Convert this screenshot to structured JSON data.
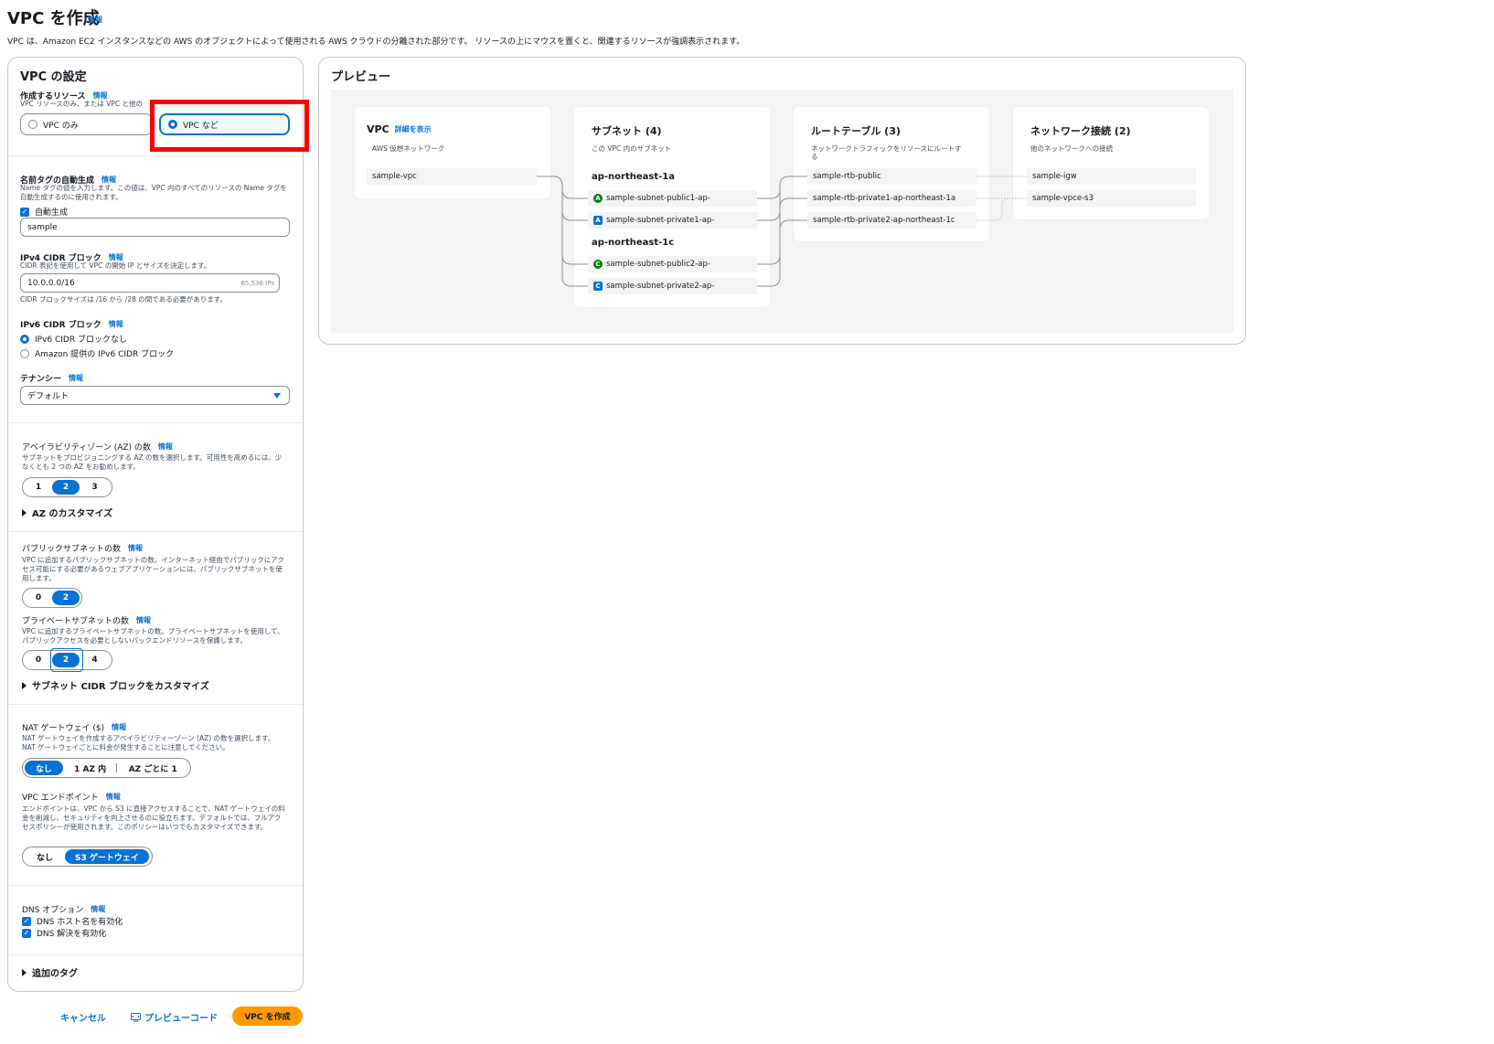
{
  "page": {
    "title": "VPC を作成",
    "info": "情報",
    "description": "VPC は、Amazon EC2 インスタンスなどの AWS のオブジェクトによって使用される AWS クラウドの分離された部分です。 リソースの上にマウスを置くと、関連するリソースが強調表示されます。"
  },
  "settings": {
    "title": "VPC の設定",
    "resources": {
      "label": "作成するリソース",
      "info": "情報",
      "desc": "VPC リソースのみ、または VPC と他の",
      "options": [
        "VPC のみ",
        "VPC など"
      ],
      "selected": "VPC など"
    },
    "name_tag": {
      "label": "名前タグの自動生成",
      "info": "情報",
      "desc": "Name タグの値を入力します。この値は、VPC 内のすべてのリソースの Name タグを自動生成するのに使用されます。",
      "checkbox": "自動生成",
      "value": "sample"
    },
    "ipv4": {
      "label": "IPv4 CIDR ブロック",
      "info": "情報",
      "desc": "CIDR 表記を使用して VPC の開始 IP とサイズを決定します。",
      "value": "10.0.0.0/16",
      "ips": "65,536 IPs",
      "hint": "CIDR ブロックサイズは /16 から /28 の間である必要があります。"
    },
    "ipv6": {
      "label": "IPv6 CIDR ブロック",
      "info": "情報",
      "options": [
        "IPv6 CIDR ブロックなし",
        "Amazon 提供の IPv6 CIDR ブロック"
      ]
    },
    "tenancy": {
      "label": "テナンシー",
      "info": "情報",
      "value": "デフォルト"
    },
    "az": {
      "label": "アベイラビリティゾーン (AZ) の数",
      "info": "情報",
      "desc": "サブネットをプロビジョニングする AZ の数を選択します。可用性を高めるには、少なくとも 2 つの AZ をお勧めします。",
      "options": [
        "1",
        "2",
        "3"
      ],
      "customize": "AZ のカスタマイズ"
    },
    "public_subnets": {
      "label": "パブリックサブネットの数",
      "info": "情報",
      "desc": "VPC に追加するパブリックサブネットの数。インターネット経由でパブリックにアクセス可能にする必要があるウェブアプリケーションには、パブリックサブネットを使用します。",
      "options": [
        "0",
        "2"
      ]
    },
    "private_subnets": {
      "label": "プライベートサブネットの数",
      "info": "情報",
      "desc": "VPC に追加するプライベートサブネットの数。プライベートサブネットを使用して、パブリックアクセスを必要としないバックエンドリソースを保護します。",
      "options": [
        "0",
        "2",
        "4"
      ],
      "customize": "サブネット CIDR ブロックをカスタマイズ"
    },
    "nat": {
      "label": "NAT ゲートウェイ ($)",
      "info": "情報",
      "desc": "NAT ゲートウェイを作成するアベイラビリティーゾーン (AZ) の数を選択します。NAT ゲートウェイごとに料金が発生することに注意してください。",
      "options": [
        "なし",
        "1 AZ 内",
        "AZ ごとに 1"
      ]
    },
    "endpoint": {
      "label": "VPC エンドポイント",
      "info": "情報",
      "desc": "エンドポイントは、VPC から S3 に直接アクセスすることで、NAT ゲートウェイの料金を削減し、セキュリティを向上させるのに役立ちます。デフォルトでは、フルアクセスポリシーが使用されます。このポリシーはいつでもカスタマイズできます。",
      "options": [
        "なし",
        "S3 ゲートウェイ"
      ]
    },
    "dns": {
      "label": "DNS オプション",
      "info": "情報",
      "options": [
        "DNS ホスト名を有効化",
        "DNS 解決を有効化"
      ]
    },
    "tags": "追加のタグ"
  },
  "actions": {
    "cancel": "キャンセル",
    "preview_code": "プレビューコード",
    "create": "VPC を作成"
  },
  "preview": {
    "title": "プレビュー",
    "vpc": {
      "title": "VPC",
      "link": "詳細を表示",
      "desc": "AWS 仮想ネットワーク",
      "items": [
        "sample-vpc"
      ]
    },
    "subnets": {
      "title": "サブネット (4)",
      "desc": "この VPC 内のサブネット",
      "groups": [
        {
          "az": "ap-northeast-1a",
          "items": [
            {
              "badge": "A",
              "kind": "pub",
              "name": "sample-subnet-public1-ap-"
            },
            {
              "badge": "A",
              "kind": "priv",
              "name": "sample-subnet-private1-ap-"
            }
          ]
        },
        {
          "az": "ap-northeast-1c",
          "items": [
            {
              "badge": "C",
              "kind": "pub",
              "name": "sample-subnet-public2-ap-"
            },
            {
              "badge": "C",
              "kind": "priv",
              "name": "sample-subnet-private2-ap-"
            }
          ]
        }
      ]
    },
    "route_tables": {
      "title": "ルートテーブル (3)",
      "desc": "ネットワークトラフィックをリソースにルートする",
      "items": [
        "sample-rtb-public",
        "sample-rtb-private1-ap-northeast-1a",
        "sample-rtb-private2-ap-northeast-1c"
      ]
    },
    "connections": {
      "title": "ネットワーク接続 (2)",
      "desc": "他のネットワークへの接続",
      "items": [
        "sample-igw",
        "sample-vpce-s3"
      ]
    }
  },
  "colors": {
    "accent": "#0972d3",
    "primary_button": "#ff9900",
    "highlight": "#ff0000",
    "public_badge": "#037f0c"
  }
}
